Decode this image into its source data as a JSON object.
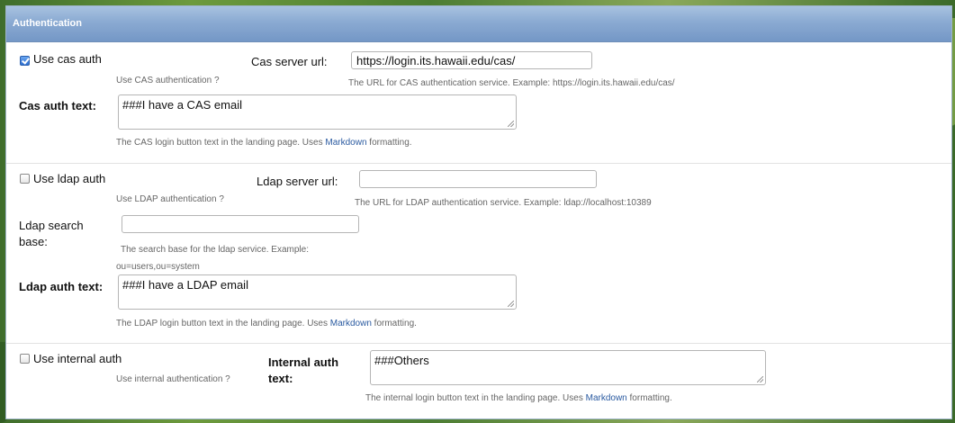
{
  "panel": {
    "title": "Authentication"
  },
  "cas": {
    "checkbox_label": "Use cas auth",
    "checked": true,
    "checkbox_help": "Use CAS authentication ?",
    "server_url_label": "Cas server url:",
    "server_url_value": "https://login.its.hawaii.edu/cas/",
    "server_url_help": "The URL for CAS authentication service. Example: https://login.its.hawaii.edu/cas/",
    "auth_text_label": "Cas auth text:",
    "auth_text_value": "###I have a CAS email",
    "auth_text_help_prefix": "The CAS login button text in the landing page. Uses ",
    "auth_text_help_link": "Markdown",
    "auth_text_help_suffix": " formatting."
  },
  "ldap": {
    "checkbox_label": "Use ldap auth",
    "checked": false,
    "checkbox_help": "Use LDAP authentication ?",
    "server_url_label": "Ldap server url:",
    "server_url_value": "",
    "server_url_help": "The URL for LDAP authentication service. Example: ldap://localhost:10389",
    "search_base_label_line1": "Ldap search",
    "search_base_label_line2": "base:",
    "search_base_value": "",
    "search_base_help_line1": "The search base for the ldap service. Example:",
    "search_base_help_line2": "ou=users,ou=system",
    "auth_text_label": "Ldap auth text:",
    "auth_text_value": "###I have a LDAP email",
    "auth_text_help_prefix": "The LDAP login button text in the landing page. Uses ",
    "auth_text_help_link": "Markdown",
    "auth_text_help_suffix": " formatting."
  },
  "internal": {
    "checkbox_label": "Use internal auth",
    "checked": false,
    "checkbox_help": "Use internal authentication ?",
    "auth_text_label_line1": "Internal auth",
    "auth_text_label_line2": "text:",
    "auth_text_value": "###Others",
    "auth_text_help_prefix": "The internal login button text in the landing page. Uses ",
    "auth_text_help_link": "Markdown",
    "auth_text_help_suffix": " formatting."
  }
}
